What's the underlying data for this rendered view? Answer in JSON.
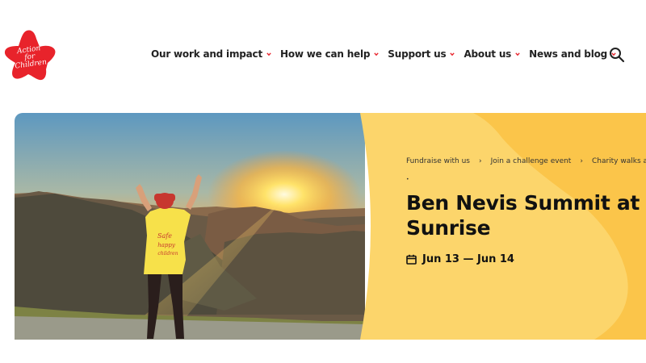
{
  "brand": {
    "logo_text": "Action for Children",
    "logo_color": "#e8232b"
  },
  "nav": {
    "items": [
      {
        "label": "Our work and impact"
      },
      {
        "label": "How we can help"
      },
      {
        "label": "Support us"
      },
      {
        "label": "About us"
      },
      {
        "label": "News and blog"
      }
    ],
    "chevron_color": "#e8232b",
    "search_icon": "search-icon"
  },
  "hero": {
    "image_alt": "Person in a yellow t-shirt with arms raised on a mountain summit at sunrise",
    "shirt_text": "Safe and happy children",
    "panel_color": "#fcd56b",
    "panel_accent": "#fbc54a",
    "breadcrumb": [
      {
        "label": "Fundraise with us"
      },
      {
        "label": "Join a challenge event"
      },
      {
        "label": "Charity walks and hikes"
      }
    ],
    "breadcrumb_separator": "›",
    "title_line1": "Ben Nevis Summit at",
    "title_line2": "Sunrise",
    "date": "Jun 13 — Jun 14",
    "date_icon": "calendar-icon"
  }
}
